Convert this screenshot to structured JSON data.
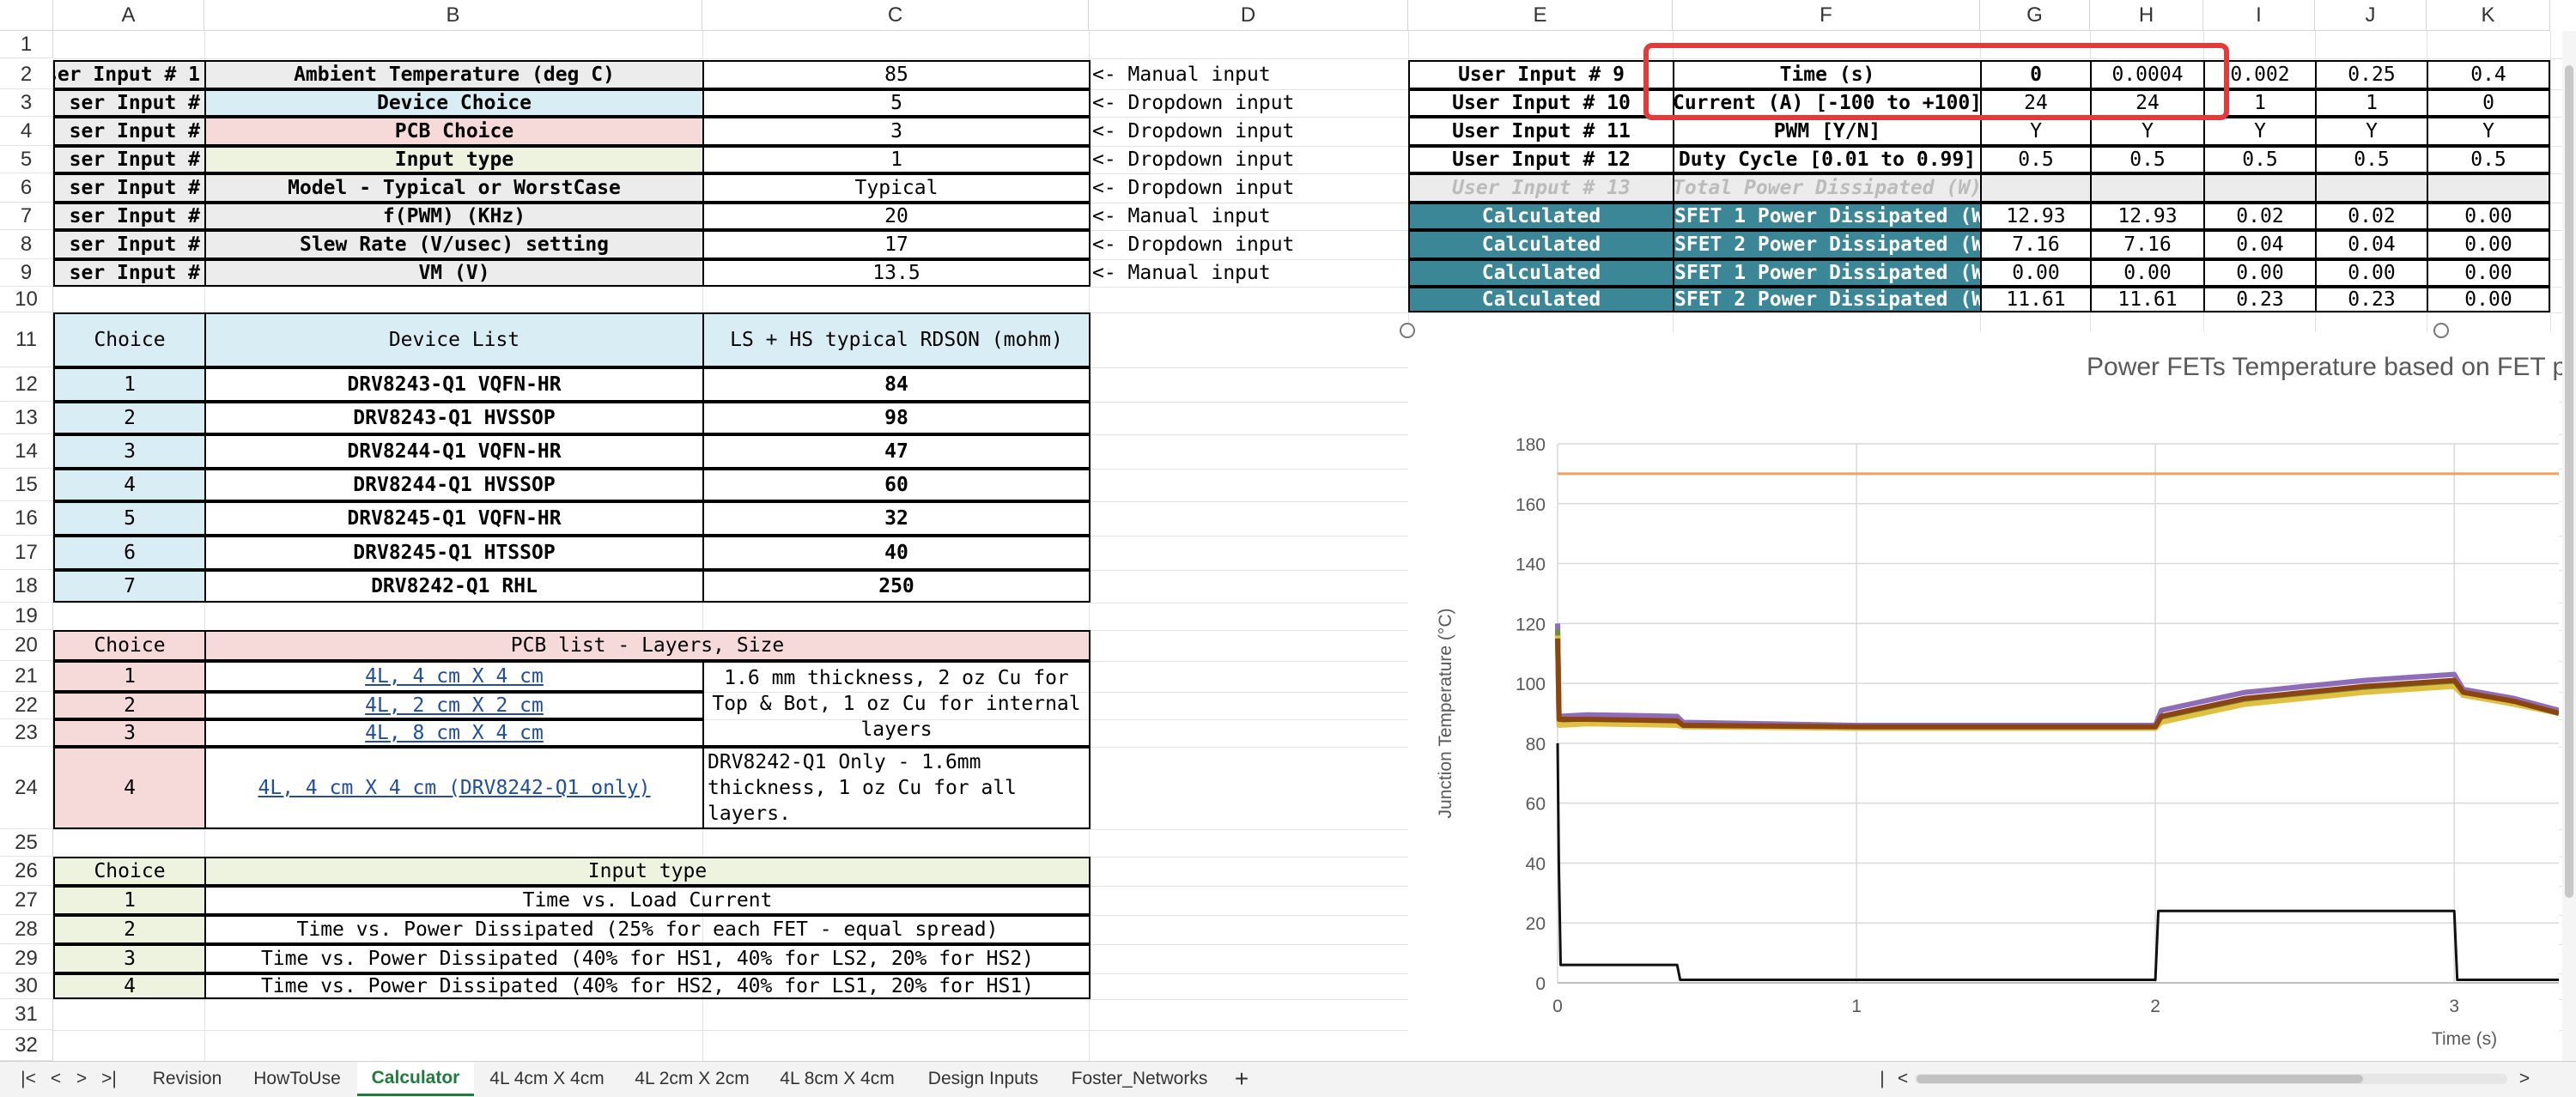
{
  "columns": [
    "A",
    "B",
    "C",
    "D",
    "E",
    "F",
    "G",
    "H",
    "I",
    "J",
    "K"
  ],
  "rows": [
    "1",
    "2",
    "3",
    "4",
    "5",
    "6",
    "7",
    "8",
    "9",
    "10",
    "11",
    "12",
    "13",
    "14",
    "15",
    "16",
    "17",
    "18",
    "19",
    "20",
    "21",
    "22",
    "23",
    "24",
    "25",
    "26",
    "27",
    "28",
    "29",
    "30",
    "31",
    "32"
  ],
  "user_inputs": [
    {
      "label": "ser Input # 1",
      "param": "Ambient Temperature (deg C)",
      "value": "85",
      "note": "<- Manual input"
    },
    {
      "label": "ser Input # ",
      "param": "Device Choice",
      "value": "5",
      "note": "<- Dropdown input"
    },
    {
      "label": "ser Input # ",
      "param": "PCB Choice",
      "value": "3",
      "note": "<- Dropdown input"
    },
    {
      "label": "ser Input # ",
      "param": "Input type",
      "value": "1",
      "note": "<- Dropdown input"
    },
    {
      "label": "ser Input # ",
      "param": "Model - Typical or WorstCase",
      "value": "Typical",
      "note": "<- Dropdown input"
    },
    {
      "label": "ser Input # ",
      "param": "f(PWM) (KHz)",
      "value": "20",
      "note": "<- Manual input"
    },
    {
      "label": "ser Input # ",
      "param": "Slew Rate (V/usec) setting",
      "value": "17",
      "note": "<- Dropdown input"
    },
    {
      "label": "ser Input # ",
      "param": "VM (V)",
      "value": "13.5",
      "note": "<- Manual input"
    }
  ],
  "device_table": {
    "headers": [
      "Choice",
      "Device List",
      "LS + HS typical RDSON (mohm)"
    ],
    "rows": [
      [
        "1",
        "DRV8243-Q1 VQFN-HR",
        "84"
      ],
      [
        "2",
        "DRV8243-Q1 HVSSOP",
        "98"
      ],
      [
        "3",
        "DRV8244-Q1 VQFN-HR",
        "47"
      ],
      [
        "4",
        "DRV8244-Q1 HVSSOP",
        "60"
      ],
      [
        "5",
        "DRV8245-Q1 VQFN-HR",
        "32"
      ],
      [
        "6",
        "DRV8245-Q1 HTSSOP",
        "40"
      ],
      [
        "7",
        "DRV8242-Q1 RHL",
        "250"
      ]
    ]
  },
  "pcb_table": {
    "headers": [
      "Choice",
      "PCB list - Layers, Size"
    ],
    "rows": [
      {
        "choice": "1",
        "name": "4L, 4 cm X 4 cm"
      },
      {
        "choice": "2",
        "name": "4L, 2 cm X 2 cm"
      },
      {
        "choice": "3",
        "name": "4L, 8 cm X 4 cm"
      },
      {
        "choice": "4",
        "name": "4L, 4 cm X 4 cm (DRV8242-Q1 only)"
      }
    ],
    "note_main": "1.6 mm thickness, 2 oz Cu for Top & Bot, 1 oz Cu for internal layers",
    "note_4": "DRV8242-Q1 Only - 1.6mm thickness, 1 oz Cu for all layers."
  },
  "input_type_table": {
    "headers": [
      "Choice",
      "Input type"
    ],
    "rows": [
      [
        "1",
        "Time vs. Load Current"
      ],
      [
        "2",
        "Time vs. Power Dissipated (25% for each FET - equal spread)"
      ],
      [
        "3",
        "Time vs. Power Dissipated (40% for HS1, 40% for LS2, 20% for HS2)"
      ],
      [
        "4",
        "Time vs. Power Dissipated (40% for HS2, 40% for LS1, 20% for HS1)"
      ]
    ]
  },
  "right_table": {
    "rows": [
      {
        "label": "User Input # 9",
        "param": "Time (s)",
        "vals": [
          "0",
          "0.0004",
          "0.002",
          "0.25",
          "0.4"
        ]
      },
      {
        "label": "User Input # 10",
        "param": "Current (A) [-100 to +100]",
        "vals": [
          "24",
          "24",
          "1",
          "1",
          "0"
        ]
      },
      {
        "label": "User Input # 11",
        "param": "PWM [Y/N]",
        "vals": [
          "Y",
          "Y",
          "Y",
          "Y",
          "Y"
        ]
      },
      {
        "label": "User Input # 12",
        "param": "Duty Cycle [0.01 to 0.99]",
        "vals": [
          "0.5",
          "0.5",
          "0.5",
          "0.5",
          "0.5"
        ]
      },
      {
        "label": "User Input # 13",
        "param": "Total Power Dissipated (W)",
        "vals": [
          "",
          "",
          "",
          "",
          ""
        ]
      },
      {
        "label": "Calculated",
        "param": "SFET 1 Power Dissipated (W",
        "vals": [
          "12.93",
          "12.93",
          "0.02",
          "0.02",
          "0.00"
        ]
      },
      {
        "label": "Calculated",
        "param": "SFET 2 Power Dissipated (W",
        "vals": [
          "7.16",
          "7.16",
          "0.04",
          "0.04",
          "0.00"
        ]
      },
      {
        "label": "Calculated",
        "param": "SFET 1 Power Dissipated (W",
        "vals": [
          "0.00",
          "0.00",
          "0.00",
          "0.00",
          "0.00"
        ]
      },
      {
        "label": "Calculated",
        "param": "SFET 2 Power Dissipated (W",
        "vals": [
          "11.61",
          "11.61",
          "0.23",
          "0.23",
          "0.00"
        ]
      }
    ]
  },
  "chart_data": {
    "type": "line",
    "title": "Power FETs Temperature based on FET p",
    "xlabel": "Time (s)",
    "ylabel": "Junction Temperature (°C)",
    "xlim": [
      0,
      3.35
    ],
    "ylim": [
      0,
      180
    ],
    "yticks": [
      "0",
      "20",
      "40",
      "60",
      "80",
      "100",
      "120",
      "140",
      "160",
      "180"
    ],
    "xticks": [
      "0",
      "1",
      "2",
      "3"
    ],
    "series": [
      {
        "color": "#f0a060",
        "points": [
          [
            0,
            170
          ],
          [
            3.35,
            170
          ]
        ]
      },
      {
        "color": "#8e6cb8",
        "points": [
          [
            0,
            120
          ],
          [
            0.005,
            89
          ],
          [
            0.1,
            89.5
          ],
          [
            0.4,
            89
          ],
          [
            0.42,
            87
          ],
          [
            1,
            86
          ],
          [
            2,
            86
          ],
          [
            2.02,
            91
          ],
          [
            2.3,
            97
          ],
          [
            2.7,
            101
          ],
          [
            3,
            103
          ],
          [
            3.03,
            98
          ],
          [
            3.2,
            95
          ],
          [
            3.35,
            91
          ]
        ]
      },
      {
        "color": "#6b8f3a",
        "points": [
          [
            0,
            118
          ],
          [
            0.005,
            87
          ],
          [
            0.1,
            87.5
          ],
          [
            0.4,
            87
          ],
          [
            0.42,
            86
          ],
          [
            1,
            85
          ],
          [
            2,
            85
          ],
          [
            2.02,
            88
          ],
          [
            2.3,
            94
          ],
          [
            2.7,
            98
          ],
          [
            3,
            100
          ],
          [
            3.03,
            97
          ],
          [
            3.2,
            94
          ],
          [
            3.35,
            90
          ]
        ]
      },
      {
        "color": "#e0c040",
        "points": [
          [
            0,
            116
          ],
          [
            0.005,
            86
          ],
          [
            0.1,
            86.5
          ],
          [
            0.4,
            86
          ],
          [
            0.42,
            85.5
          ],
          [
            1,
            85
          ],
          [
            2,
            85
          ],
          [
            2.02,
            87
          ],
          [
            2.3,
            93
          ],
          [
            2.7,
            97
          ],
          [
            3,
            99
          ],
          [
            3.03,
            96
          ],
          [
            3.2,
            93
          ],
          [
            3.35,
            90
          ]
        ]
      },
      {
        "color": "#8b4513",
        "points": [
          [
            0,
            115
          ],
          [
            0.005,
            88
          ],
          [
            0.1,
            88
          ],
          [
            0.4,
            87.5
          ],
          [
            0.42,
            86
          ],
          [
            1,
            85.5
          ],
          [
            2,
            85.5
          ],
          [
            2.02,
            89
          ],
          [
            2.3,
            95
          ],
          [
            2.7,
            99
          ],
          [
            3,
            101
          ],
          [
            3.03,
            97
          ],
          [
            3.2,
            94
          ],
          [
            3.35,
            90
          ]
        ]
      },
      {
        "color": "#111111",
        "points": [
          [
            0,
            80
          ],
          [
            0.004,
            40
          ],
          [
            0.01,
            6
          ],
          [
            0.25,
            6
          ],
          [
            0.4,
            6
          ],
          [
            0.41,
            1
          ],
          [
            2,
            1
          ],
          [
            2.01,
            24
          ],
          [
            3,
            24
          ],
          [
            3.01,
            1
          ],
          [
            3.35,
            1
          ]
        ]
      }
    ]
  },
  "sheet_tabs": [
    "Revision",
    "HowToUse",
    "Calculator",
    "4L 4cm X 4cm",
    "4L 2cm X 2cm",
    "4L 8cm X 4cm",
    "Design Inputs",
    "Foster_Networks"
  ],
  "active_tab": "Calculator",
  "add_sheet": "+"
}
